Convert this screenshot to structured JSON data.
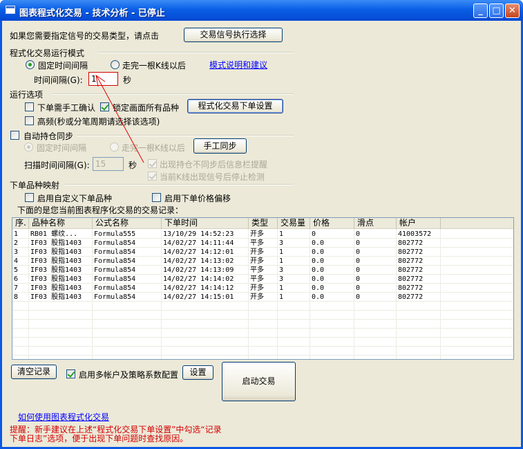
{
  "window": {
    "title": "图表程式化交易 - 技术分析 - 已停止"
  },
  "signal": {
    "prompt": "如果您需要指定信号的交易类型，请点击",
    "button": "交易信号执行选择"
  },
  "mode": {
    "title": "程式化交易运行模式",
    "radio_fixed": "固定时间间隔",
    "radio_kline": "走完一根K线以后",
    "help_link": "模式说明和建议",
    "interval_label": "时间间隔(G):",
    "interval_value": "1",
    "interval_unit": "秒"
  },
  "options": {
    "title": "运行选项",
    "manual_confirm": "下单需手工确认",
    "lock_products": "锁定画面所有品种",
    "order_settings": "程式化交易下单设置",
    "high_freq": "高频(秒或分笔周期请选择该选项)"
  },
  "sync": {
    "title": "自动持仓同步",
    "radio_fixed": "固定时间间隔",
    "radio_kline": "走完一根K线以后",
    "manual_sync": "手工同步",
    "scan_label": "扫描时间间隔(G):",
    "scan_value": "15",
    "scan_unit": "秒",
    "notify_mismatch": "出现持仓不同步后信息栏提醒",
    "stop_detect": "当前K线出现信号后停止检测"
  },
  "mapping": {
    "title": "下单品种映射",
    "custom_product": "启用自定义下单品种",
    "price_offset": "启用下单价格偏移"
  },
  "records": {
    "caption": "下面的是您当前图表程序化交易的交易记录：",
    "columns": [
      "序.",
      "品种名称",
      "公式名称",
      "下单时间",
      "类型",
      "交易量",
      "价格",
      "滑点",
      "帐户"
    ],
    "rows": [
      [
        "1",
        "RB01 螺纹...",
        "Formula555",
        "13/10/29 14:52:23",
        "开多",
        "1",
        "0",
        "0",
        "41003572"
      ],
      [
        "2",
        "IF03 股指1403",
        "Formula854",
        "14/02/27 14:11:44",
        "平多",
        "3",
        "0.0",
        "0",
        "802772"
      ],
      [
        "3",
        "IF03 股指1403",
        "Formula854",
        "14/02/27 14:12:01",
        "开多",
        "1",
        "0.0",
        "0",
        "802772"
      ],
      [
        "4",
        "IF03 股指1403",
        "Formula854",
        "14/02/27 14:13:02",
        "开多",
        "1",
        "0.0",
        "0",
        "802772"
      ],
      [
        "5",
        "IF03 股指1403",
        "Formula854",
        "14/02/27 14:13:09",
        "平多",
        "3",
        "0.0",
        "0",
        "802772"
      ],
      [
        "6",
        "IF03 股指1403",
        "Formula854",
        "14/02/27 14:14:02",
        "平多",
        "3",
        "0.0",
        "0",
        "802772"
      ],
      [
        "7",
        "IF03 股指1403",
        "Formula854",
        "14/02/27 14:14:12",
        "开多",
        "1",
        "0.0",
        "0",
        "802772"
      ],
      [
        "8",
        "IF03 股指1403",
        "Formula854",
        "14/02/27 14:15:01",
        "开多",
        "1",
        "0.0",
        "0",
        "802772"
      ]
    ]
  },
  "bottom": {
    "clear": "清空记录",
    "multi_account": "启用多帐户及策略系数配置",
    "settings": "设置",
    "start": "启动交易",
    "help_link": "如何使用图表程式化交易",
    "tip_line1": "提醒：新手建议在上述“程式化交易下单设置”中勾选“记录",
    "tip_line2": "下单日志”选项，便于出现下单问题时查找原因。"
  },
  "colors": {
    "tip": "#d40000",
    "link": "#0000ff",
    "annotation_arrow": "#e00000"
  }
}
